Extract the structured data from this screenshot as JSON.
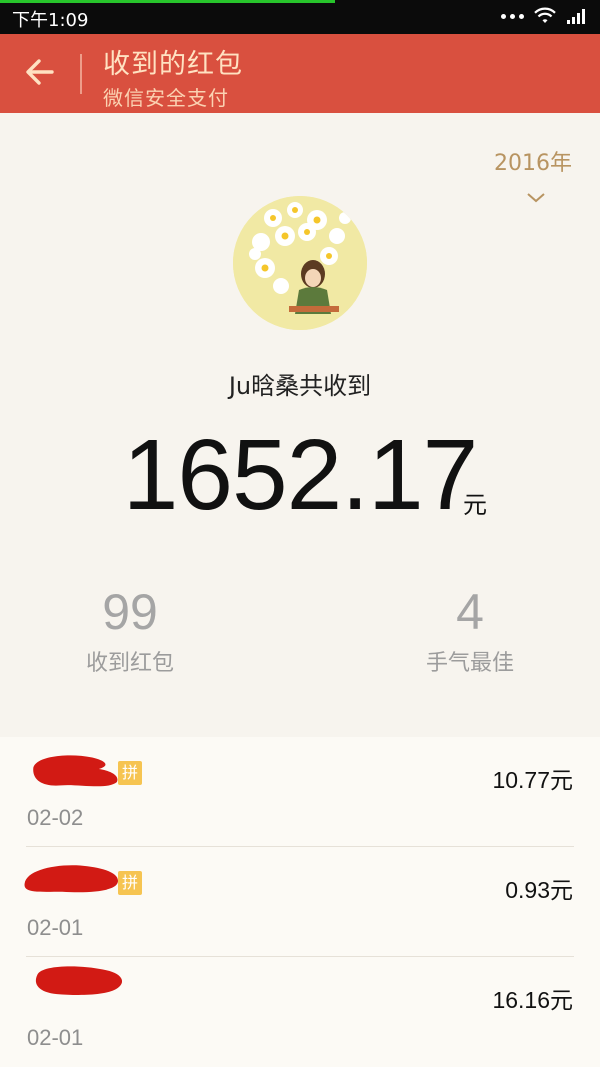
{
  "status_bar": {
    "time": "下午1:09",
    "icons": [
      "more-dots-icon",
      "wifi-icon",
      "signal-icon"
    ]
  },
  "header": {
    "title": "收到的红包",
    "subtitle": "微信安全支付",
    "back_icon": "back-arrow-icon"
  },
  "summary": {
    "year": "2016年",
    "owner_line": "Ju晗桑共收到",
    "total_amount": "1652.17",
    "total_unit": "元",
    "received_count": "99",
    "received_label": "收到红包",
    "best_luck_count": "4",
    "best_luck_label": "手气最佳"
  },
  "packets": [
    {
      "badge": "拼",
      "date": "02-02",
      "amount": "10.77元"
    },
    {
      "badge": "拼",
      "date": "02-01",
      "amount": "0.93元"
    },
    {
      "badge": "",
      "date": "02-01",
      "amount": "16.16元"
    }
  ],
  "colors": {
    "header_bg": "#d9503f",
    "accent_gold": "#b89461",
    "badge": "#f6c451",
    "redaction": "#d21a14"
  }
}
